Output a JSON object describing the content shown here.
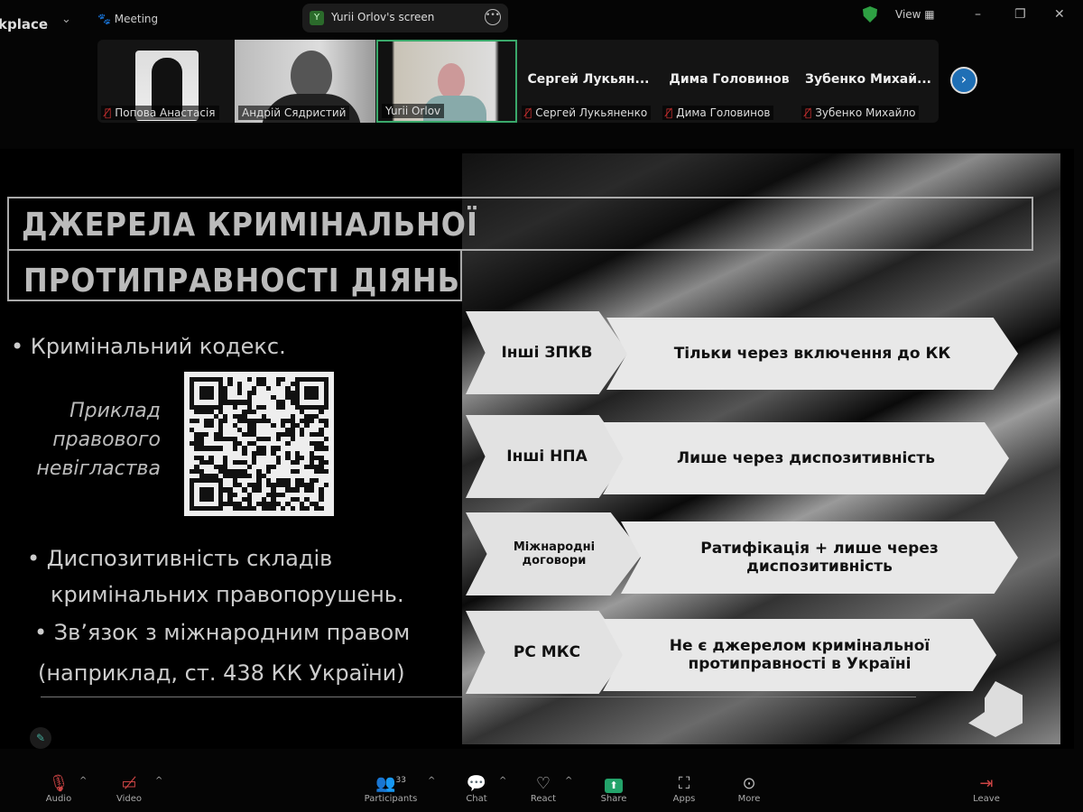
{
  "topbar": {
    "app_name": "kplace",
    "meeting_label": "Meeting",
    "share_initial": "Y",
    "share_label": "Yurii Orlov's screen",
    "view_label": "View"
  },
  "participants": [
    {
      "name": "Попова Анастасія",
      "muted": true
    },
    {
      "name": "Андрій Сядристий",
      "muted": false
    },
    {
      "name": "Yurii Orlov",
      "muted": false,
      "active": true
    },
    {
      "name": "Сергей Лукьяненко",
      "display": "Сергей  Лукьян...",
      "muted": true
    },
    {
      "name": "Дима Головинов",
      "display": "Дима Головинов",
      "muted": true
    },
    {
      "name": "Зубенко Михайло",
      "display": "Зубенко  Михай...",
      "muted": true
    }
  ],
  "slide": {
    "title_line1": "ДЖЕРЕЛА  КРИМІНАЛЬНОЇ",
    "title_line2": "ПРОТИПРАВНОСТІ  ДІЯНЬ",
    "bullet1": "Кримінальний кодекс.",
    "example": [
      "Приклад",
      "правового",
      "невігластва"
    ],
    "bullet2_l1": "Диспозитивність складів",
    "bullet2_l2": "кримінальних правопорушень.",
    "bullet3": "Зв’язок з міжнародним правом",
    "bullet3_note": "(наприклад, ст. 438 КК України)",
    "rows": [
      {
        "left": "Інші ЗПКВ",
        "right": "Тільки через включення до КК"
      },
      {
        "left": "Інші НПА",
        "right": "Лише через диспозитивність"
      },
      {
        "left": "Міжнародні договори",
        "right": "Ратифікація + лише через диспозитивність"
      },
      {
        "left": "РС МКС",
        "right": "Не є джерелом кримінальної протиправності в Україні"
      }
    ]
  },
  "toolbar": {
    "audio": "Audio",
    "video": "Video",
    "participants": "Participants",
    "participants_count": "33",
    "chat": "Chat",
    "react": "React",
    "share": "Share",
    "apps": "Apps",
    "more": "More",
    "leave": "Leave"
  },
  "colors": {
    "share_green": "#23a36a",
    "active_border": "#3aa86a",
    "next_blue": "#1f6fb5"
  }
}
